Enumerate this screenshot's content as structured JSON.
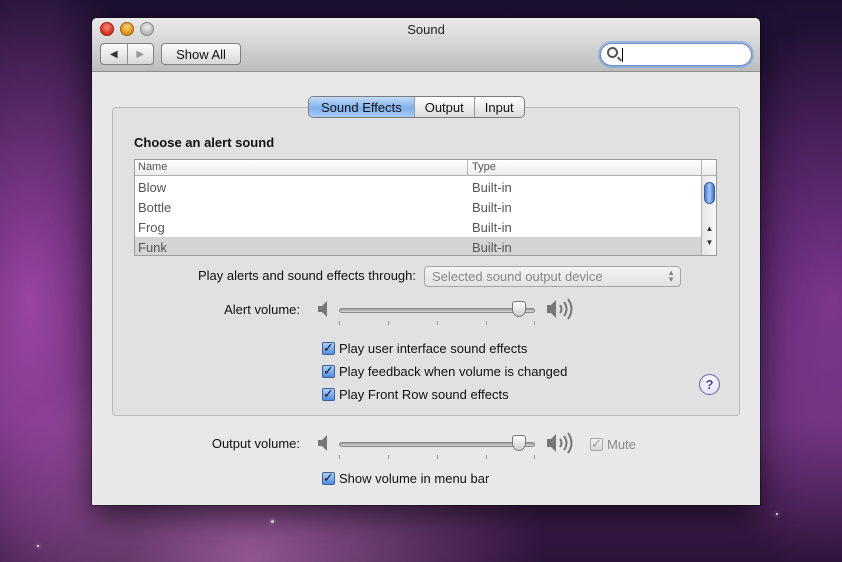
{
  "window": {
    "title": "Sound"
  },
  "toolbar": {
    "back_glyph": "◀",
    "forward_glyph": "▶",
    "show_all_label": "Show All",
    "search_value": ""
  },
  "tabs": [
    {
      "label": "Sound Effects",
      "active": true
    },
    {
      "label": "Output",
      "active": false
    },
    {
      "label": "Input",
      "active": false
    }
  ],
  "alert_section": {
    "heading": "Choose an alert sound",
    "columns": [
      "Name",
      "Type"
    ],
    "rows": [
      {
        "name": "Blow",
        "type": "Built-in",
        "selected": false
      },
      {
        "name": "Bottle",
        "type": "Built-in",
        "selected": false
      },
      {
        "name": "Frog",
        "type": "Built-in",
        "selected": false
      },
      {
        "name": "Funk",
        "type": "Built-in",
        "selected": true
      }
    ]
  },
  "play_through": {
    "label": "Play alerts and sound effects through:",
    "value": "Selected sound output device"
  },
  "alert_volume": {
    "label": "Alert volume:",
    "level": 0.95
  },
  "checkboxes": [
    {
      "label": "Play user interface sound effects",
      "checked": true
    },
    {
      "label": "Play feedback when volume is changed",
      "checked": true
    },
    {
      "label": "Play Front Row sound effects",
      "checked": true
    }
  ],
  "help_glyph": "?",
  "output_volume": {
    "label": "Output volume:",
    "level": 0.95,
    "mute_label": "Mute",
    "mute_checked": true
  },
  "show_volume": {
    "label": "Show volume in menu bar",
    "checked": true
  },
  "colors": {
    "accent": "#4f8fe6",
    "selection": "#d4d4d4",
    "window_bg": "#e8e8e8"
  }
}
